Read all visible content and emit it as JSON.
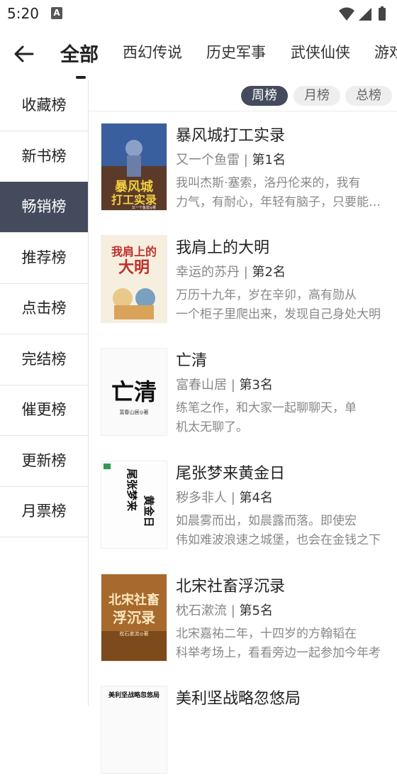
{
  "status": {
    "time": "5:20"
  },
  "tabs": [
    {
      "label": "全部",
      "active": true
    },
    {
      "label": "西幻传说"
    },
    {
      "label": "历史军事"
    },
    {
      "label": "武侠仙侠"
    },
    {
      "label": "游戏"
    }
  ],
  "sidebar": [
    {
      "label": "收藏榜"
    },
    {
      "label": "新书榜"
    },
    {
      "label": "畅销榜",
      "active": true
    },
    {
      "label": "推荐榜"
    },
    {
      "label": "点击榜"
    },
    {
      "label": "完结榜"
    },
    {
      "label": "催更榜"
    },
    {
      "label": "更新榜"
    },
    {
      "label": "月票榜"
    }
  ],
  "periods": [
    {
      "label": "周榜",
      "active": true
    },
    {
      "label": "月榜"
    },
    {
      "label": "总榜"
    }
  ],
  "books": [
    {
      "title": "暴风城打工实录",
      "author": "又一个鱼雷 | ",
      "rank": "第1名",
      "desc1": "我叫杰斯·塞索，洛丹伦来的，我有",
      "desc2": "力气，有耐心，年轻有脑子，只要能给口饭吃",
      "cover_text": [
        "暴风城",
        "打工实录"
      ],
      "cover_author": "又一个鱼雷◎著"
    },
    {
      "title": "我肩上的大明",
      "author": "幸运的苏丹 | ",
      "rank": "第2名",
      "desc1": "万历十九年，岁在辛卯，高有勋从",
      "desc2": "一个柜子里爬出来，发现自己身处大明",
      "cover_text": [
        "我肩上的",
        "大明"
      ]
    },
    {
      "title": "亡清",
      "author": "富春山居 | ",
      "rank": "第3名",
      "desc1": "练笔之作，和大家一起聊聊天，单",
      "desc2": "机太无聊了。",
      "cover_text": [
        "亡清"
      ],
      "cover_author": "富春山居◎著"
    },
    {
      "title": "尾张梦来黄金日",
      "author": "秽多非人 | ",
      "rank": "第4名",
      "desc1": "如晨雾而出，如晨露而落。即使宏",
      "desc2": "伟如难波浪速之城堡，也会在金钱之下",
      "cover_text": [
        "尾张梦来",
        "黄金日"
      ]
    },
    {
      "title": "北宋社畜浮沉录",
      "author": "枕石漱流 | ",
      "rank": "第5名",
      "desc1": "北宋嘉祐二年，十四岁的方翰韬在",
      "desc2": "科举考场上，看看旁边一起参加今年考",
      "cover_text": [
        "北宋社畜",
        "浮沉录"
      ],
      "cover_author": "枕石漱流◎著"
    },
    {
      "title": "美利坚战略忽悠局",
      "author": "",
      "rank": "",
      "desc1": "",
      "desc2": "",
      "cover_text": [
        "美利坚战略忽悠局"
      ]
    }
  ]
}
